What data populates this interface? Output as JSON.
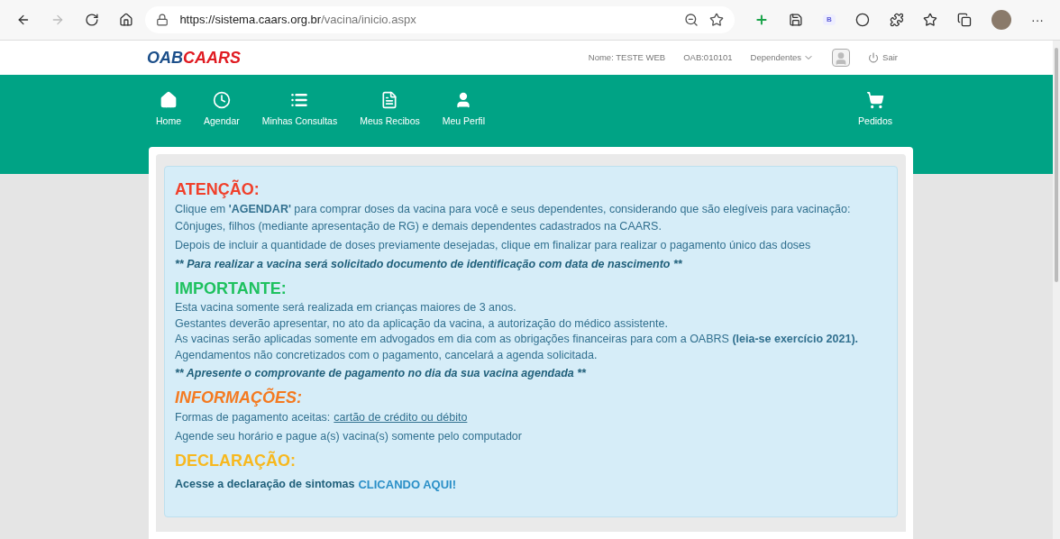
{
  "browser": {
    "url_host": "https://sistema.caars.org.br",
    "url_path": "/vacina/inicio.aspx",
    "extension_letter": "B",
    "menu": "···"
  },
  "header": {
    "logo_left": "OAB",
    "logo_right": "CAARS",
    "user_name": "Nome: TESTE WEB",
    "oab": "OAB:010101",
    "dependents": "Dependentes",
    "logout": "Sair"
  },
  "nav": {
    "items": [
      {
        "label": "Home",
        "kind": "home"
      },
      {
        "label": "Agendar",
        "kind": "clock"
      },
      {
        "label": "Minhas Consultas",
        "kind": "list"
      },
      {
        "label": "Meus Recibos",
        "kind": "file"
      },
      {
        "label": "Meu Perfil",
        "kind": "user"
      }
    ],
    "cart": {
      "label": "Pedidos"
    }
  },
  "sections": [
    {
      "title": "ATENÇÃO:",
      "color": "#f0402b",
      "italic": false,
      "lines": [
        {
          "kind": "text",
          "text": "Clique em **'AGENDAR'** para comprar doses da vacina para você e seus dependentes, considerando que são elegíveis para vacinação: Cônjuges, filhos (mediante apresentação de RG) e demais dependentes cadastrados na CAARS."
        },
        {
          "kind": "text",
          "text": "Depois de incluir a quantidade de doses previamente desejadas, clique em finalizar para realizar o pagamento único das doses"
        },
        {
          "kind": "note",
          "text": "** Para realizar a vacina será solicitado documento de identificação com data de nascimento **"
        }
      ]
    },
    {
      "title": "IMPORTANTE:",
      "color": "#1ec15f",
      "italic": false,
      "lines": [
        {
          "kind": "tight",
          "text": "Esta vacina somente será realizada em crianças maiores de 3 anos."
        },
        {
          "kind": "tight",
          "text": "Gestantes deverão apresentar, no ato da aplicação da vacina, a autorização do médico assistente."
        },
        {
          "kind": "tight",
          "text": "As vacinas serão aplicadas somente em advogados em dia com as obrigações financeiras para com a OABRS **(leia-se exercício 2021).**"
        },
        {
          "kind": "tight",
          "text": "Agendamentos não concretizados com o pagamento, cancelará a agenda solicitada."
        },
        {
          "kind": "note",
          "text": "** Apresente o comprovante de pagamento no dia da sua vacina agendada **"
        }
      ]
    },
    {
      "title": "INFORMAÇÕES:",
      "color": "#f47a20",
      "italic": true,
      "lines": [
        {
          "kind": "link",
          "text": "Formas de pagamento aceitas:",
          "link": "cartão de crédito ou débito"
        },
        {
          "kind": "text",
          "text": "Agende seu horário e pague a(s) vacina(s) somente pelo computador"
        }
      ]
    },
    {
      "title": "DECLARAÇÃO:",
      "color": "#f7b81e",
      "italic": false,
      "lines": [
        {
          "kind": "cta",
          "text": "Acesse a declaração de sintomas",
          "link": "CLICANDO AQUI!"
        }
      ]
    }
  ]
}
